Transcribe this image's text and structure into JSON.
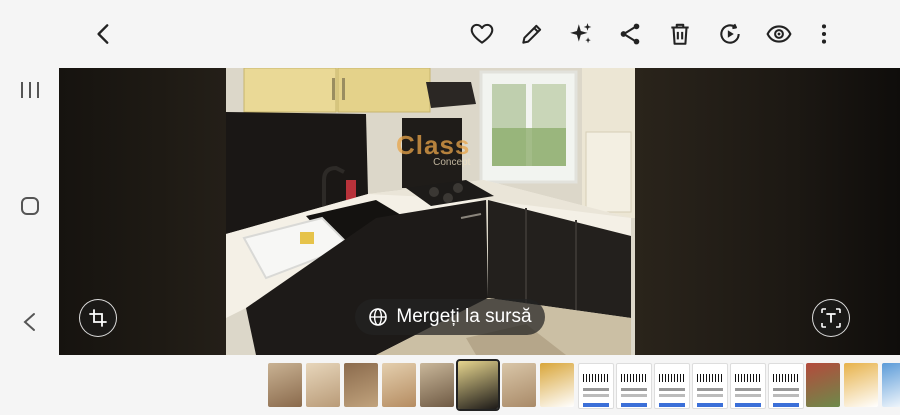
{
  "toolbar": {
    "back_icon": "chevron-left-icon",
    "actions": [
      "heart-icon",
      "pencil-icon",
      "sparkle-icon",
      "share-icon",
      "trash-icon",
      "play-circle-icon",
      "eye-icon",
      "more-vertical-icon"
    ]
  },
  "android_nav": [
    "recent-apps-icon",
    "home-icon",
    "back-icon"
  ],
  "viewer": {
    "watermark_brand": "Class",
    "watermark_sub": "Concept",
    "source_button_label": "Mergeți la sursă",
    "source_icon": "globe-icon",
    "left_tool_icon": "crop-icon",
    "right_tool_icon": "text-extract-icon"
  },
  "filmstrip": {
    "selected_index": 5,
    "thumbnails": [
      "hallway",
      "living-room",
      "bedroom",
      "bedroom-2",
      "room",
      "kitchen",
      "room-2",
      "document",
      "barcode-doc",
      "barcode-doc-2",
      "barcode-doc-3",
      "barcode-doc-4",
      "barcode-doc-5",
      "barcode-doc-6",
      "outdoor",
      "app-screen",
      "app-screen-2"
    ]
  },
  "colors": {
    "toolbar_bg": "#f5f5f5",
    "viewer_bg": "#0b0a08"
  }
}
